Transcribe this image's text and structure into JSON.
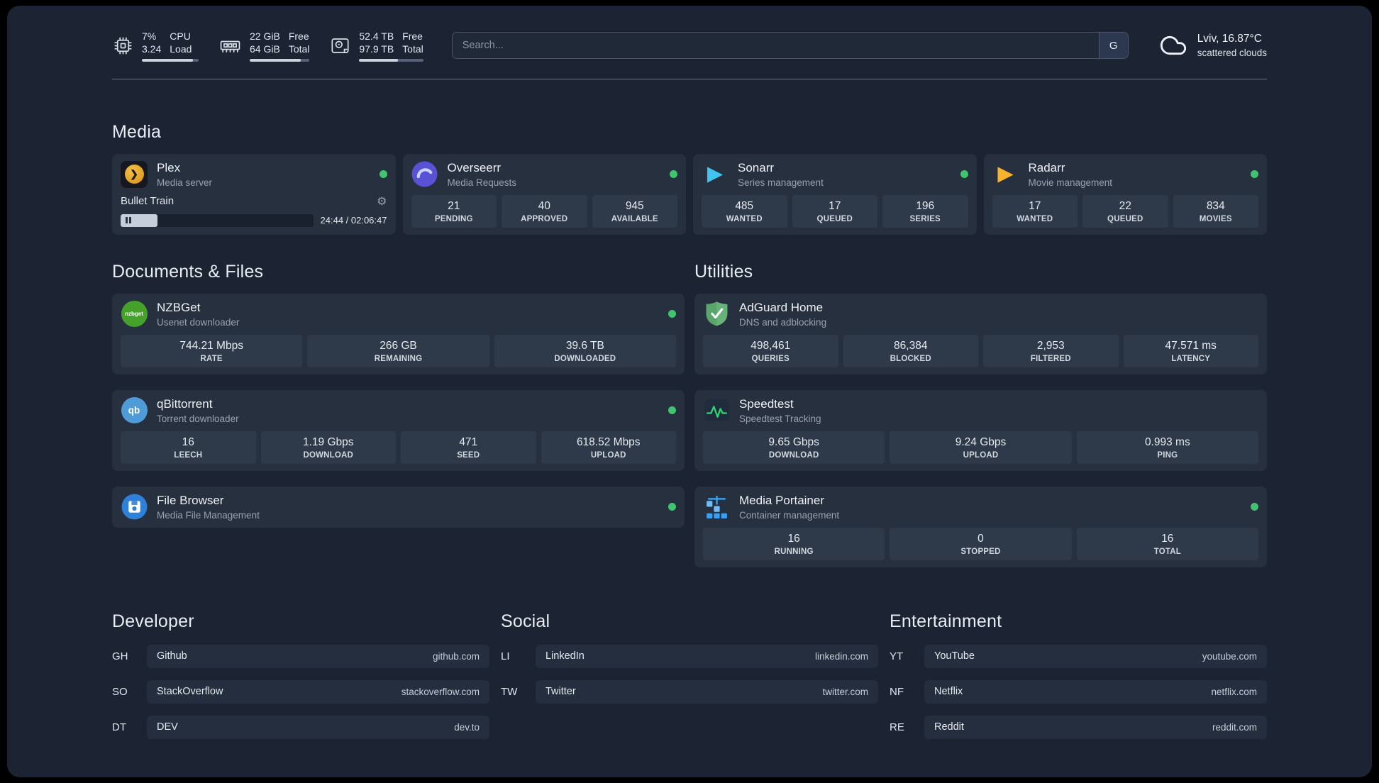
{
  "topbar": {
    "cpu": {
      "value_top": "7%",
      "value_bottom": "3.24",
      "label_top": "CPU",
      "label_bottom": "Load",
      "bar_percent": 90
    },
    "memory": {
      "value_top": "22 GiB",
      "value_bottom": "64 GiB",
      "label_top": "Free",
      "label_bottom": "Total",
      "bar_percent": 85
    },
    "disk": {
      "value_top": "52.4 TB",
      "value_bottom": "97.9 TB",
      "label_top": "Free",
      "label_bottom": "Total",
      "bar_percent": 60
    },
    "search": {
      "placeholder": "Search...",
      "engine_label": "G"
    },
    "weather": {
      "location": "Lviv, 16.87°C",
      "condition": "scattered clouds"
    }
  },
  "media": {
    "title": "Media",
    "plex": {
      "name": "Plex",
      "desc": "Media server",
      "now_playing": "Bullet Train",
      "time": "24:44 / 02:06:47",
      "progress_percent": 19
    },
    "cards": [
      {
        "name": "Overseerr",
        "desc": "Media Requests",
        "stats": [
          {
            "value": "21",
            "label": "PENDING"
          },
          {
            "value": "40",
            "label": "APPROVED"
          },
          {
            "value": "945",
            "label": "AVAILABLE"
          }
        ]
      },
      {
        "name": "Sonarr",
        "desc": "Series management",
        "stats": [
          {
            "value": "485",
            "label": "WANTED"
          },
          {
            "value": "17",
            "label": "QUEUED"
          },
          {
            "value": "196",
            "label": "SERIES"
          }
        ]
      },
      {
        "name": "Radarr",
        "desc": "Movie management",
        "stats": [
          {
            "value": "17",
            "label": "WANTED"
          },
          {
            "value": "22",
            "label": "QUEUED"
          },
          {
            "value": "834",
            "label": "MOVIES"
          }
        ]
      }
    ]
  },
  "documents": {
    "title": "Documents & Files",
    "cards": [
      {
        "name": "NZBGet",
        "desc": "Usenet downloader",
        "stats": [
          {
            "value": "744.21 Mbps",
            "label": "RATE"
          },
          {
            "value": "266 GB",
            "label": "REMAINING"
          },
          {
            "value": "39.6 TB",
            "label": "DOWNLOADED"
          }
        ]
      },
      {
        "name": "qBittorrent",
        "desc": "Torrent downloader",
        "stats": [
          {
            "value": "16",
            "label": "LEECH"
          },
          {
            "value": "1.19 Gbps",
            "label": "DOWNLOAD"
          },
          {
            "value": "471",
            "label": "SEED"
          },
          {
            "value": "618.52 Mbps",
            "label": "UPLOAD"
          }
        ]
      },
      {
        "name": "File Browser",
        "desc": "Media File Management",
        "stats": []
      }
    ]
  },
  "utilities": {
    "title": "Utilities",
    "cards": [
      {
        "name": "AdGuard Home",
        "desc": "DNS and adblocking",
        "stats": [
          {
            "value": "498,461",
            "label": "QUERIES"
          },
          {
            "value": "86,384",
            "label": "BLOCKED"
          },
          {
            "value": "2,953",
            "label": "FILTERED"
          },
          {
            "value": "47.571 ms",
            "label": "LATENCY"
          }
        ]
      },
      {
        "name": "Speedtest",
        "desc": "Speedtest Tracking",
        "stats": [
          {
            "value": "9.65 Gbps",
            "label": "DOWNLOAD"
          },
          {
            "value": "9.24 Gbps",
            "label": "UPLOAD"
          },
          {
            "value": "0.993 ms",
            "label": "PING"
          }
        ]
      },
      {
        "name": "Media Portainer",
        "desc": "Container management",
        "stats": [
          {
            "value": "16",
            "label": "RUNNING"
          },
          {
            "value": "0",
            "label": "STOPPED"
          },
          {
            "value": "16",
            "label": "TOTAL"
          }
        ]
      }
    ]
  },
  "bookmarks": [
    {
      "title": "Developer",
      "items": [
        {
          "abbr": "GH",
          "name": "Github",
          "domain": "github.com"
        },
        {
          "abbr": "SO",
          "name": "StackOverflow",
          "domain": "stackoverflow.com"
        },
        {
          "abbr": "DT",
          "name": "DEV",
          "domain": "dev.to"
        }
      ]
    },
    {
      "title": "Social",
      "items": [
        {
          "abbr": "LI",
          "name": "LinkedIn",
          "domain": "linkedin.com"
        },
        {
          "abbr": "TW",
          "name": "Twitter",
          "domain": "twitter.com"
        }
      ]
    },
    {
      "title": "Entertainment",
      "items": [
        {
          "abbr": "YT",
          "name": "YouTube",
          "domain": "youtube.com"
        },
        {
          "abbr": "NF",
          "name": "Netflix",
          "domain": "netflix.com"
        },
        {
          "abbr": "RE",
          "name": "Reddit",
          "domain": "reddit.com"
        }
      ]
    }
  ],
  "icons": {
    "gear": "⚙",
    "plex_chevron": "❯",
    "sonarr_play": "▶",
    "radarr_play": "▶",
    "nzbget_text": "nzbget",
    "qbittorrent_text": "qb"
  },
  "colors": {
    "background": "#1c2434",
    "card": "#27303f",
    "stat_box": "#2e3949",
    "status_green": "#41c46f",
    "plex_gold": "#e5a00d",
    "overseerr_purple": "#5a52d5",
    "sonarr_blue": "#41c3f0",
    "radarr_gold": "#f7b32b",
    "nzbget_green": "#44a22b",
    "qbittorrent_blue": "#4f9bd8",
    "adguard_green": "#67b279",
    "speedtest_green": "#2dd36f",
    "portainer_blue": "#3a9ff1",
    "filebrowser_blue": "#2f80d9"
  }
}
